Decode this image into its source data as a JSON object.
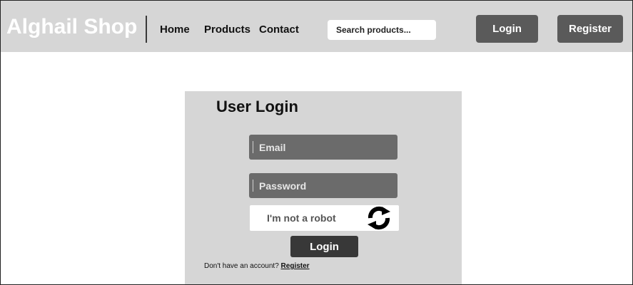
{
  "header": {
    "brand": "Alghail Shop",
    "nav": [
      {
        "label": "Home"
      },
      {
        "label": "Products"
      },
      {
        "label": "Contact"
      }
    ],
    "search": {
      "placeholder": "Search products..."
    },
    "login_label": "Login",
    "register_label": "Register"
  },
  "login_card": {
    "title": "User Login",
    "email": {
      "placeholder": "Email",
      "value": ""
    },
    "password": {
      "placeholder": "Password",
      "value": ""
    },
    "captcha": {
      "label": "I'm not a robot",
      "icon": "recaptcha-refresh-icon"
    },
    "submit_label": "Login",
    "footer": {
      "prompt": "Don't have an account?",
      "register_link": "Register"
    }
  },
  "colors": {
    "header_bg": "#d6d6d6",
    "card_bg": "#d6d6d6",
    "button_bg": "#5a5a5a",
    "field_bg": "#6b6b6b",
    "submit_bg": "#383838"
  }
}
